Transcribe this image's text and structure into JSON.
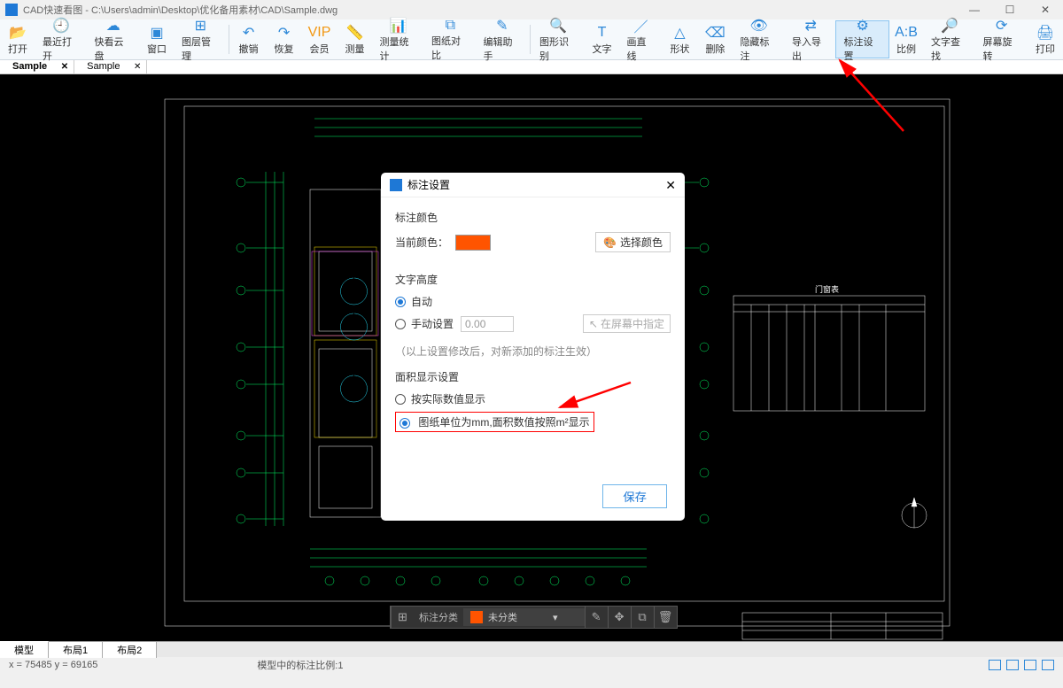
{
  "title": "CAD快速看图 - C:\\Users\\admin\\Desktop\\优化备用素材\\CAD\\Sample.dwg",
  "toolbar": [
    {
      "id": "open",
      "label": "打开",
      "icon": "📂"
    },
    {
      "id": "recent",
      "label": "最近打开",
      "icon": "🕘"
    },
    {
      "id": "cloud",
      "label": "快看云盘",
      "icon": "☁"
    },
    {
      "id": "window",
      "label": "窗口",
      "icon": "▣"
    },
    {
      "id": "layer",
      "label": "图层管理",
      "icon": "⊞"
    },
    {
      "sep": true
    },
    {
      "id": "undo",
      "label": "撤销",
      "icon": "↶"
    },
    {
      "id": "redo",
      "label": "恢复",
      "icon": "↷"
    },
    {
      "id": "vip",
      "label": "会员",
      "icon": "VIP",
      "vip": true
    },
    {
      "id": "measure",
      "label": "测量",
      "icon": "📏"
    },
    {
      "id": "stats",
      "label": "测量统计",
      "icon": "📊"
    },
    {
      "id": "compare",
      "label": "图纸对比",
      "icon": "⧉"
    },
    {
      "id": "edit",
      "label": "编辑助手",
      "icon": "✎"
    },
    {
      "sep": true
    },
    {
      "id": "recog",
      "label": "图形识别",
      "icon": "🔍"
    },
    {
      "id": "text",
      "label": "文字",
      "icon": "T"
    },
    {
      "id": "line",
      "label": "画直线",
      "icon": "／"
    },
    {
      "id": "shape",
      "label": "形状",
      "icon": "△"
    },
    {
      "id": "delete",
      "label": "删除",
      "icon": "⌫"
    },
    {
      "id": "hide",
      "label": "隐藏标注",
      "icon": "👁"
    },
    {
      "id": "io",
      "label": "导入导出",
      "icon": "⇄"
    },
    {
      "id": "dimset",
      "label": "标注设置",
      "icon": "⚙",
      "highlight": true
    },
    {
      "id": "scale",
      "label": "比例",
      "icon": "A:B"
    },
    {
      "id": "find",
      "label": "文字查找",
      "icon": "🔎"
    },
    {
      "id": "rotate",
      "label": "屏幕旋转",
      "icon": "⟳"
    },
    {
      "id": "print",
      "label": "打印",
      "icon": "🖨"
    }
  ],
  "tabs": [
    {
      "label": "Sample",
      "active": true
    },
    {
      "label": "Sample",
      "active": false
    }
  ],
  "dialog": {
    "title": "标注设置",
    "section_color": "标注颜色",
    "current_color_label": "当前颜色：",
    "choose_color": "选择颜色",
    "section_height": "文字高度",
    "opt_auto": "自动",
    "opt_manual": "手动设置",
    "manual_value": "0.00",
    "screen_pick": "在屏幕中指定",
    "note": "（以上设置修改后，对新添加的标注生效）",
    "section_area": "面积显示设置",
    "opt_real": "按实际数值显示",
    "opt_mm": "图纸单位为mm,面积数值按照m²显示",
    "save": "保存"
  },
  "canvasbar": {
    "label": "标注分类",
    "drop": "未分类"
  },
  "layouts": [
    "模型",
    "布局1",
    "布局2"
  ],
  "status": {
    "coords": "x = 75485  y = 69165",
    "scale": "模型中的标注比例:1"
  },
  "table_title": "门窗表"
}
